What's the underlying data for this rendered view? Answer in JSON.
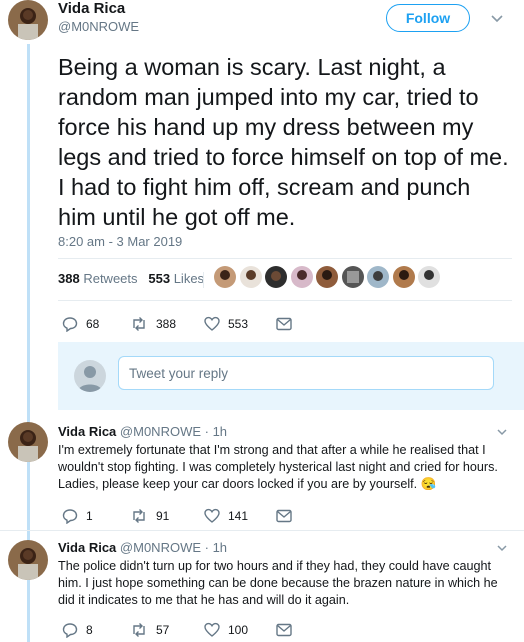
{
  "tweet": {
    "author_name": "Vida Rica",
    "author_handle": "@M0NROWE",
    "follow_label": "Follow",
    "text": "Being a woman is scary. Last night, a random man jumped into my car, tried to force his hand up my dress between my legs and tried to force himself on top of me. I had to fight him off, scream and punch him until he got off me.",
    "timestamp": "8:20 am - 3 Mar 2019",
    "retweets_count": "388",
    "retweets_label": "Retweets",
    "likes_count": "553",
    "likes_label": "Likes",
    "actions": {
      "replies": "68",
      "retweets": "388",
      "likes": "553"
    }
  },
  "reply_box": {
    "placeholder": "Tweet your reply"
  },
  "replies": [
    {
      "author_name": "Vida Rica",
      "author_handle": "@M0NROWE",
      "time": "· 1h",
      "text": "I'm extremely fortunate that I'm strong and that after a while he realised that I wouldn't stop fighting. I was completely hysterical last night and cried for hours. Ladies, please keep your car doors locked if you are by yourself. 😪",
      "actions": {
        "replies": "1",
        "retweets": "91",
        "likes": "141"
      }
    },
    {
      "author_name": "Vida Rica",
      "author_handle": "@M0NROWE",
      "time": "· 1h",
      "text": "The police didn't turn up for two hours and if they had, they could have caught him. I just hope something can be done because the brazen nature in which he did it indicates to me that he has and will do it again.",
      "actions": {
        "replies": "8",
        "retweets": "57",
        "likes": "100"
      }
    }
  ],
  "colors": {
    "accent": "#1da1f2",
    "secondary_text": "#657786",
    "thread_line": "#bfe0f7",
    "reply_bg": "#e8f5fd"
  },
  "icons": [
    "reply-icon",
    "retweet-icon",
    "heart-icon",
    "dm-icon",
    "chevron-down-icon"
  ]
}
